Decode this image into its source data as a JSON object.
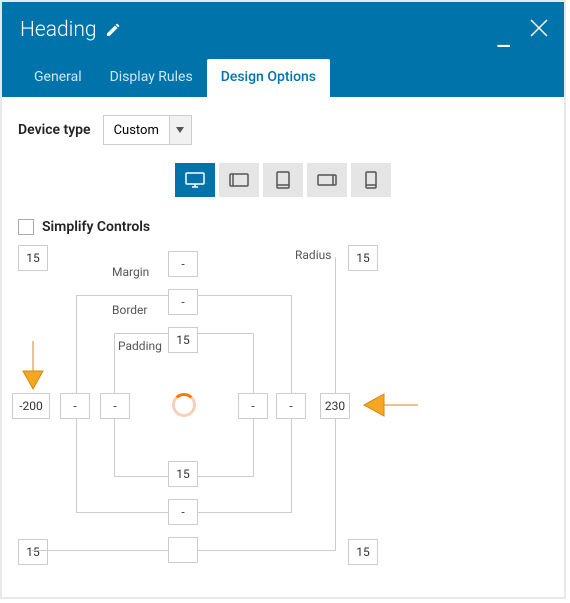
{
  "titlebar": {
    "title": "Heading"
  },
  "tabs": {
    "general": "General",
    "display_rules": "Display Rules",
    "design_options": "Design Options",
    "active": "design_options"
  },
  "device": {
    "label": "Device type",
    "value": "Custom"
  },
  "simplify": {
    "label": "Simplify Controls",
    "checked": false
  },
  "labels": {
    "radius": "Radius",
    "margin": "Margin",
    "border": "Border",
    "padding": "Padding"
  },
  "box": {
    "radius": {
      "tl": "15",
      "tr": "15",
      "bl": "15",
      "br": "15"
    },
    "margin": {
      "top": "-",
      "right": "230",
      "bottom": "",
      "left": "-200"
    },
    "border": {
      "top": "-",
      "right": "-",
      "bottom": "-",
      "left": "-"
    },
    "padding": {
      "top": "15",
      "right": "-",
      "bottom": "15",
      "left": "-"
    }
  },
  "colors": {
    "primary": "#0073aa",
    "arrow": "#f5a623"
  }
}
